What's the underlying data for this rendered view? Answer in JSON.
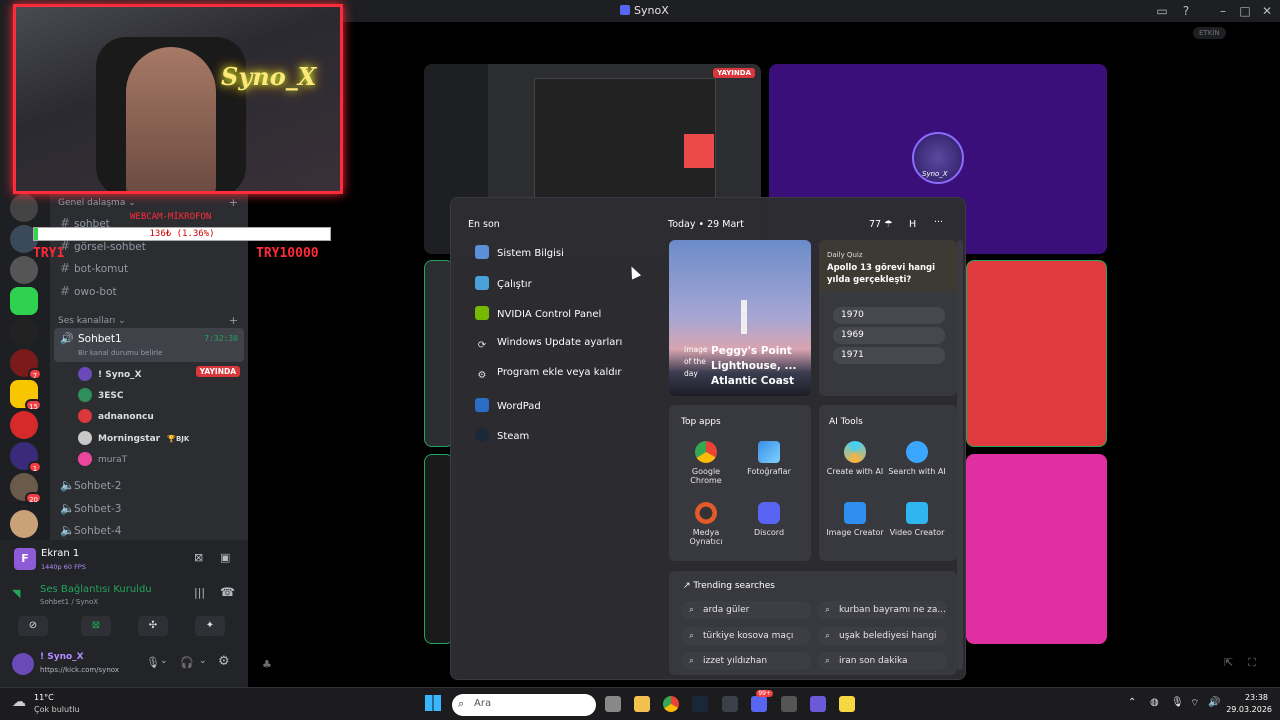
{
  "window": {
    "title": "SynoX"
  },
  "rail": {
    "badges": [
      "7",
      "15",
      "1",
      "20"
    ]
  },
  "channels": {
    "category_text": "Genel dalaşma",
    "text_channels": [
      "sohbet",
      "görsel-sohbet",
      "bot-komut",
      "owo-bot"
    ],
    "category_voice": "Ses kanalları",
    "active_voice": {
      "name": "Sohbet1",
      "time": "7:32:30",
      "status_placeholder": "Bir kanal durumu belirle"
    },
    "voice_users": [
      {
        "name": "! Syno_X",
        "badge": "YAYINDA",
        "color": "#6a4ab8"
      },
      {
        "name": "3ESC",
        "badge": "",
        "color": "#2f8f5b"
      },
      {
        "name": "adnanoncu",
        "badge": "",
        "color": "#da373c"
      },
      {
        "name": "Morningstar",
        "badge": "BJK",
        "color": "#c8c8c8"
      },
      {
        "name": "muraT",
        "badge": "",
        "color": "#eb459e"
      }
    ],
    "other_voice": [
      "Sohbet-2",
      "Sohbet-3",
      "Sohbet-4"
    ]
  },
  "panel": {
    "stream_title": "Ekran 1",
    "stream_quality": "1440p 60 FPS",
    "voice_status": "Ses Bağlantısı Kuruldu",
    "voice_location": "Sohbet1 / SynoX",
    "username": "! Syno_X",
    "user_status": "https://kick.com/synox"
  },
  "overlay": {
    "cam_name": "Syno_X",
    "cam_label": "WEBCAM-MİKROFON",
    "goal_text": "136₺ (1.36%)",
    "goal_progress": 0.0136,
    "try_left": "TRY1",
    "try_right": "TRY10000"
  },
  "stage": {
    "live_label": "YAYINDA",
    "enabled_pill": "ETKİN",
    "avatar_name": "Syno_X"
  },
  "start_menu": {
    "recent_title": "En son",
    "recent_items": [
      "Sistem Bilgisi",
      "Çalıştır",
      "NVIDIA Control Panel",
      "Windows Update ayarları",
      "Program ekle veya kaldır",
      "WordPad",
      "Steam"
    ],
    "today_label": "Today",
    "date": "29 Mart",
    "temp": "77",
    "user_initial": "H",
    "more": "···",
    "image_card": {
      "caption_l1": "Image",
      "caption_l2": "of the",
      "caption_l3": "day",
      "title": "Peggy's Point Lighthouse, ... Atlantic Coast"
    },
    "quiz": {
      "label": "Daily Quiz",
      "question": "Apollo 13 görevi hangi yılda gerçekleşti?",
      "options": [
        "1970",
        "1969",
        "1971"
      ]
    },
    "top_apps_title": "Top apps",
    "top_apps": [
      {
        "l1": "Google",
        "l2": "Chrome"
      },
      {
        "l1": "Fotoğraflar",
        "l2": ""
      },
      {
        "l1": "Medya",
        "l2": "Oynatıcı"
      },
      {
        "l1": "Discord",
        "l2": ""
      }
    ],
    "ai_title": "AI Tools",
    "ai_tools": [
      "Create with AI",
      "Search with AI",
      "Image Creator",
      "Video Creator"
    ],
    "trending_title": "Trending searches",
    "trending": [
      "arda güler",
      "kurban bayramı ne za...",
      "türkiye kosova maçı",
      "uşak belediyesi hangi ...",
      "izzet yıldızhan",
      "iran son dakika"
    ]
  },
  "taskbar": {
    "weather_temp": "11°C",
    "weather_text": "Çok bulutlu",
    "search_placeholder": "Ara",
    "time": "23:38",
    "date": "29.03.2026",
    "notif_badge": "99+"
  }
}
